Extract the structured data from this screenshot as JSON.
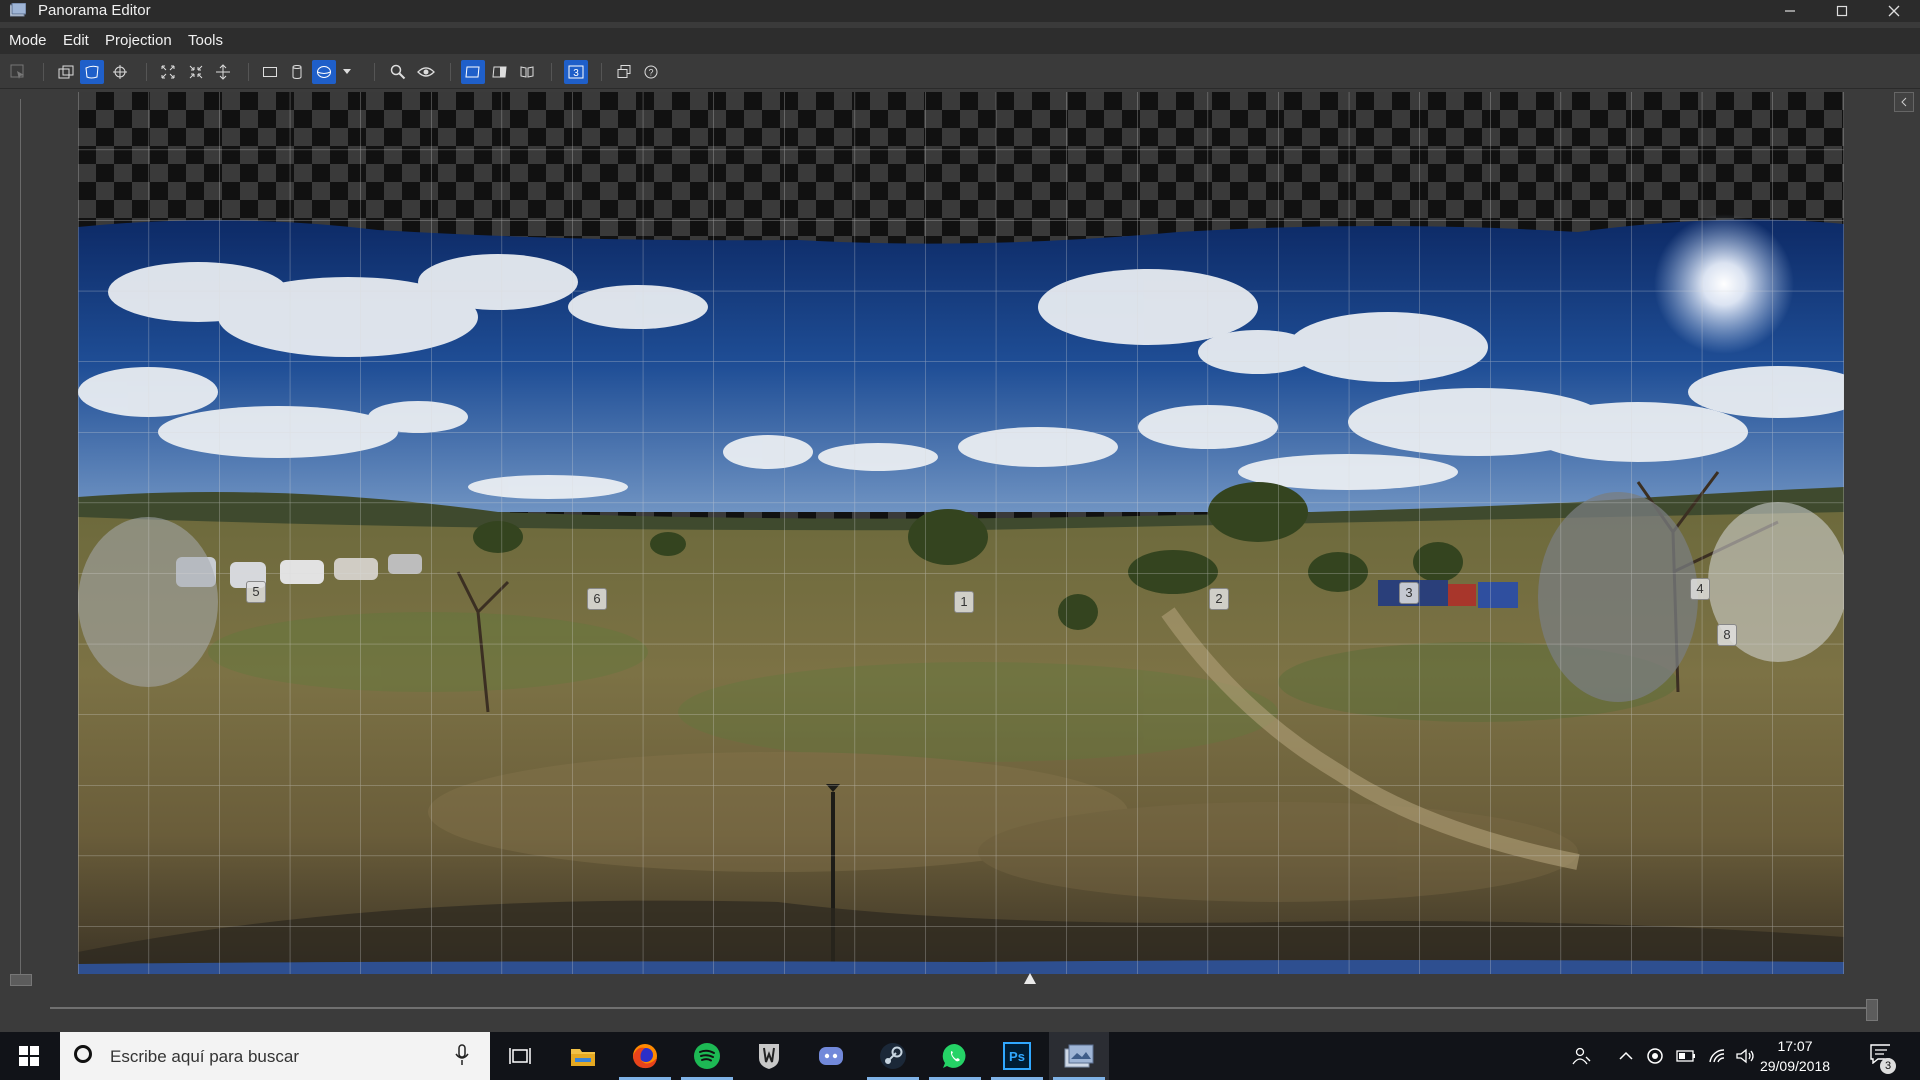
{
  "window": {
    "title": "Panorama Editor"
  },
  "menu": {
    "items": [
      "Mode",
      "Edit",
      "Projection",
      "Tools"
    ]
  },
  "toolbar": {
    "buttons": [
      {
        "icon": "select-icon",
        "active": false
      },
      {
        "icon": "image-stack-icon",
        "active": false
      },
      {
        "icon": "warp-icon",
        "active": true
      },
      {
        "icon": "crosshair-icon",
        "active": false
      },
      {
        "icon": "fit-icon",
        "active": false
      },
      {
        "icon": "shrink-icon",
        "active": false
      },
      {
        "icon": "horizon-icon",
        "active": false
      },
      {
        "icon": "rectilinear-icon",
        "active": false
      },
      {
        "icon": "cylindrical-icon",
        "active": false
      },
      {
        "icon": "spherical-icon",
        "active": true
      },
      {
        "icon": "dropdown-arrow-icon",
        "active": false
      },
      {
        "icon": "zoom-icon",
        "active": false
      },
      {
        "icon": "eye-icon",
        "active": false
      },
      {
        "icon": "view-full-icon",
        "active": true
      },
      {
        "icon": "view-half-icon",
        "active": false
      },
      {
        "icon": "view-split-icon",
        "active": false
      },
      {
        "icon": "numbers-icon",
        "active": true
      },
      {
        "icon": "layers-icon",
        "active": false
      },
      {
        "icon": "help-icon",
        "active": false
      }
    ]
  },
  "panorama": {
    "control_points": [
      "5",
      "6",
      "1",
      "2",
      "3",
      "4",
      "8"
    ]
  },
  "taskbar": {
    "search_placeholder": "Escribe aquí para buscar",
    "apps": [
      "task-view",
      "file-explorer",
      "firefox",
      "spotify",
      "world-of-tanks",
      "discord",
      "steam",
      "whatsapp",
      "photoshop",
      "panorama-editor"
    ],
    "time": "17:07",
    "date": "29/09/2018",
    "notification_count": "3"
  },
  "colors": {
    "accent": "#1f5fc9",
    "taskbar": "#111318",
    "titlebar": "#2b2b2b"
  }
}
